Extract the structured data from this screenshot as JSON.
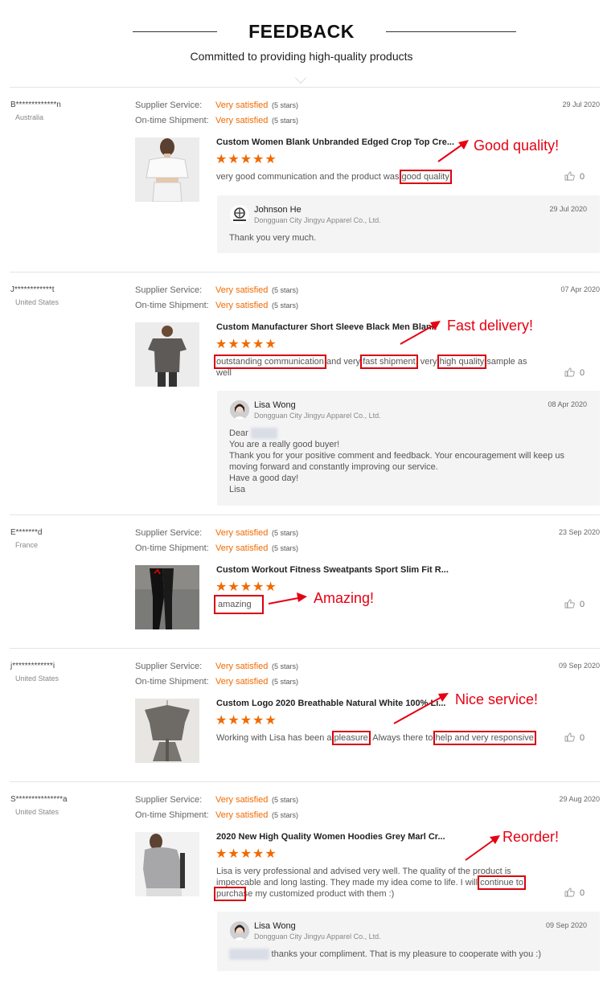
{
  "header": {
    "title": "FEEDBACK",
    "subtitle": "Committed to providing high-quality products"
  },
  "labels": {
    "supplier_service": "Supplier Service:",
    "ontime_shipment": "On-time Shipment:",
    "very_satisfied": "Very satisfied",
    "five_stars": "(5 stars)",
    "star_glyphs": "★★★★★"
  },
  "accent_color": "#f06a00",
  "annotation_color": "#e60012",
  "reviews": [
    {
      "buyer": "B*************n",
      "country": "Australia",
      "date": "29 Jul 2020",
      "product": "Custom Women Blank Unbranded Edged Crop Top Cre...",
      "comment_pre": "very good communication and the product was ",
      "hl1": "good quality",
      "likes": "0",
      "annotation": "Good quality!",
      "reply": {
        "name": "Johnson He",
        "company": "Dongguan City Jingyu Apparel Co., Ltd.",
        "date": "29 Jul 2020",
        "text": "Thank you very much."
      }
    },
    {
      "buyer": "J************t",
      "country": "United States",
      "date": "07 Apr 2020",
      "product": "Custom Manufacturer Short Sleeve Black Men Blank",
      "hl1": "outstanding communication",
      "mid1": " and very ",
      "hl2": "fast shipment",
      "mid2": ", very ",
      "hl3": "high quality",
      "tail": " sample as well",
      "likes": "0",
      "annotation": "Fast delivery!",
      "reply": {
        "name": "Lisa Wong",
        "company": "Dongguan City Jingyu Apparel Co., Ltd.",
        "date": "08 Apr 2020",
        "line1": "Dear",
        "line2": "You are a really good buyer!",
        "line3": "Thank you for your positive comment and feedback. Your encouragement will keep us moving forward and constantly improving our service.",
        "line4": "Have a good day!",
        "line5": "Lisa"
      }
    },
    {
      "buyer": "E*******d",
      "country": "France",
      "date": "23 Sep 2020",
      "product": "Custom Workout Fitness Sweatpants Sport Slim Fit R...",
      "hl1": "amazing",
      "likes": "0",
      "annotation": "Amazing!"
    },
    {
      "buyer": "j*************i",
      "country": "United States",
      "date": "09 Sep 2020",
      "product": "Custom Logo 2020 Breathable Natural White 100% Li...",
      "comment_pre": "Working with Lisa has been a ",
      "hl1": "pleasure",
      "mid1": ". Always there to ",
      "hl2": "help and very responsive",
      "likes": "0",
      "annotation": "Nice service!"
    },
    {
      "buyer": "S***************a",
      "country": "United States",
      "date": "29 Aug 2020",
      "product": "2020 New High Quality Women Hoodies Grey Marl Cr...",
      "comment_pre": "Lisa is very professional and advised very well. The quality of the product is impeccable and long lasting. They made my idea come to life. I will ",
      "hl1": "continue to purcha",
      "tail": "se my customized product with them :)",
      "likes": "0",
      "annotation": "Reorder!",
      "reply": {
        "name": "Lisa Wong",
        "company": "Dongguan City Jingyu Apparel Co., Ltd.",
        "date": "09 Sep 2020",
        "text": " thanks your compliment. That is my pleasure to cooperate with you :)"
      }
    }
  ]
}
